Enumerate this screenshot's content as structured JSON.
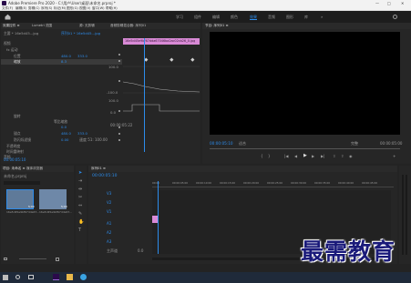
{
  "window": {
    "title": "Adobe Premiere Pro 2020 - C:\\用户\\User\\桌面\\未命名.prproj *",
    "controls": [
      "—",
      "□",
      "✕"
    ]
  },
  "menu": [
    "文件(F)",
    "编辑(E)",
    "剪辑(C)",
    "序列(S)",
    "标记(M)",
    "图形(G)",
    "视图(V)",
    "窗口(W)",
    "帮助(H)"
  ],
  "workspaces": {
    "items": [
      "学习",
      "组件",
      "编辑",
      "颜色",
      "效果",
      "音频",
      "图形",
      "库"
    ],
    "active": "效果"
  },
  "effect_controls": {
    "tabs": [
      "效果控件 ≡",
      "Lumetri 范围",
      "源: 无剪辑",
      "音频剪辑混合器: 序列01"
    ],
    "master_label": "主要 * 16e5d45...jpg",
    "seq_label": "序列01 * 16e5d45...jpg",
    "clip_name": "16e5d45e9bf67dda67046ba2ac02cb26_0.jpg",
    "section_video": "视频",
    "fx_motion": "fx 运动",
    "prop_position": "位置",
    "prop_position_x": "480.0",
    "prop_position_y": "333.0",
    "prop_scale": "缩放",
    "prop_scale_value": "8.3",
    "val_100": "100.0",
    "val_neg100": "-100.0",
    "val_100b": "100.0",
    "val_0": "0.0",
    "prop_rotate": "旋转",
    "prop_uniform": "等比缩放",
    "prop_anchor": "锚点",
    "prop_anchor_x": "480.0",
    "prop_anchor_y": "333.0",
    "prop_antiflicker": "防闪烁滤镜",
    "prop_antiflicker_value": "0.00",
    "prop_rot_value": "0.0",
    "prop_opacity": "不透明度",
    "prop_time_remap": "时间重映射",
    "section_audio": "音频",
    "fx_volume": "fx 音量",
    "timecode": "00:00:05:10",
    "small_time": "00:00:05:22",
    "speed_label": "速度 51: 100.00"
  },
  "program_monitor": {
    "tab": "节目: 序列01 ≡",
    "timecode_left": "00:00:05:10",
    "fit_label": "适合",
    "quality_label": "完整",
    "timecode_right": "00:00:05:00"
  },
  "project_panel": {
    "tabs": [
      "项目: 未命名 ≡",
      "媒体浏览器",
      "库",
      "信息"
    ],
    "project_file": "未命名.prproj",
    "items": [
      {
        "name": "16e5d45e9bf67dda67...",
        "duration": "5:00"
      },
      {
        "name": "16e5d45e9bf67dda67...",
        "duration": "5:00"
      }
    ]
  },
  "timeline": {
    "tab": "序列01 ≡",
    "timecode": "00:00:05:10",
    "ruler": [
      "00:00",
      "00:00:05:00",
      "00:00:10:00",
      "00:00:15:00",
      "00:00:20:00",
      "00:00:25:00",
      "00:00:30:00",
      "00:00:35:00",
      "00:00:40:00",
      "00:00:45:00"
    ],
    "video_tracks": [
      "V3",
      "V2",
      "V1"
    ],
    "audio_tracks": [
      "A1",
      "A2",
      "A3"
    ],
    "master_label": "主声道",
    "master_value": "0.0"
  },
  "watermark": "最需教育",
  "colors": {
    "accent": "#2d8ceb",
    "clip_pink": "#d98ad6",
    "playhead": "#2d8ceb",
    "panel_bg": "#262626"
  }
}
